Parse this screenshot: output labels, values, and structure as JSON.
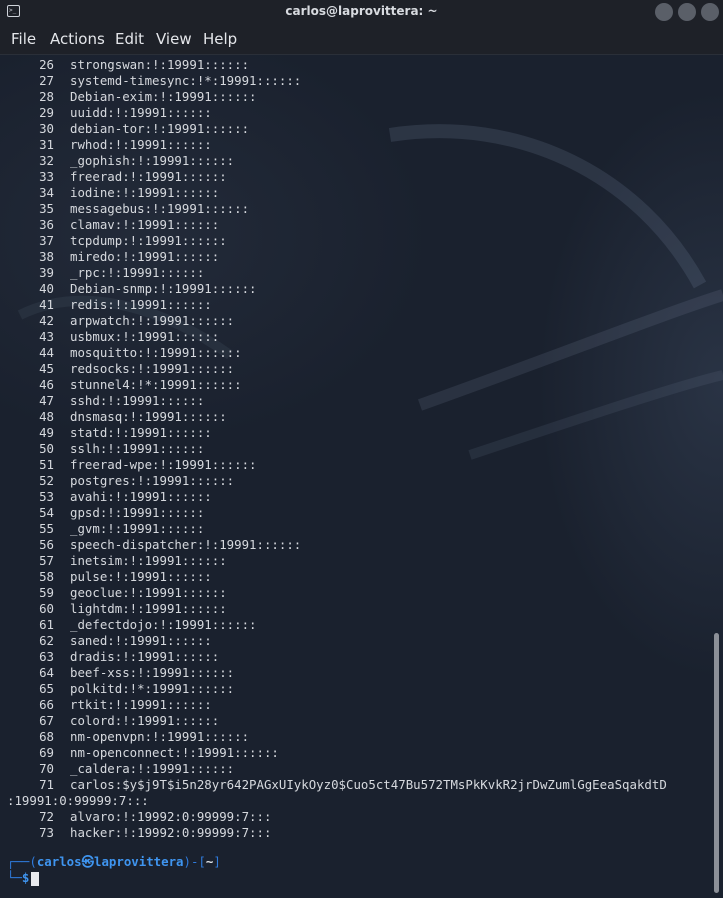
{
  "window": {
    "title": "carlos@laprovittera: ~",
    "icon": "terminal-icon"
  },
  "menu": {
    "items": [
      "File",
      "Actions",
      "Edit",
      "View",
      "Help"
    ]
  },
  "terminal": {
    "lines": [
      {
        "num": "26",
        "text": "strongswan:!:19991::::::"
      },
      {
        "num": "27",
        "text": "systemd-timesync:!*:19991::::::"
      },
      {
        "num": "28",
        "text": "Debian-exim:!:19991::::::"
      },
      {
        "num": "29",
        "text": "uuidd:!:19991::::::"
      },
      {
        "num": "30",
        "text": "debian-tor:!:19991::::::"
      },
      {
        "num": "31",
        "text": "rwhod:!:19991::::::"
      },
      {
        "num": "32",
        "text": "_gophish:!:19991::::::"
      },
      {
        "num": "33",
        "text": "freerad:!:19991::::::"
      },
      {
        "num": "34",
        "text": "iodine:!:19991::::::"
      },
      {
        "num": "35",
        "text": "messagebus:!:19991::::::"
      },
      {
        "num": "36",
        "text": "clamav:!:19991::::::"
      },
      {
        "num": "37",
        "text": "tcpdump:!:19991::::::"
      },
      {
        "num": "38",
        "text": "miredo:!:19991::::::"
      },
      {
        "num": "39",
        "text": "_rpc:!:19991::::::"
      },
      {
        "num": "40",
        "text": "Debian-snmp:!:19991::::::"
      },
      {
        "num": "41",
        "text": "redis:!:19991::::::"
      },
      {
        "num": "42",
        "text": "arpwatch:!:19991::::::"
      },
      {
        "num": "43",
        "text": "usbmux:!:19991::::::"
      },
      {
        "num": "44",
        "text": "mosquitto:!:19991::::::"
      },
      {
        "num": "45",
        "text": "redsocks:!:19991::::::"
      },
      {
        "num": "46",
        "text": "stunnel4:!*:19991::::::"
      },
      {
        "num": "47",
        "text": "sshd:!:19991::::::"
      },
      {
        "num": "48",
        "text": "dnsmasq:!:19991::::::"
      },
      {
        "num": "49",
        "text": "statd:!:19991::::::"
      },
      {
        "num": "50",
        "text": "sslh:!:19991::::::"
      },
      {
        "num": "51",
        "text": "freerad-wpe:!:19991::::::"
      },
      {
        "num": "52",
        "text": "postgres:!:19991::::::"
      },
      {
        "num": "53",
        "text": "avahi:!:19991::::::"
      },
      {
        "num": "54",
        "text": "gpsd:!:19991::::::"
      },
      {
        "num": "55",
        "text": "_gvm:!:19991::::::"
      },
      {
        "num": "56",
        "text": "speech-dispatcher:!:19991::::::"
      },
      {
        "num": "57",
        "text": "inetsim:!:19991::::::"
      },
      {
        "num": "58",
        "text": "pulse:!:19991::::::"
      },
      {
        "num": "59",
        "text": "geoclue:!:19991::::::"
      },
      {
        "num": "60",
        "text": "lightdm:!:19991::::::"
      },
      {
        "num": "61",
        "text": "_defectdojo:!:19991::::::"
      },
      {
        "num": "62",
        "text": "saned:!:19991::::::"
      },
      {
        "num": "63",
        "text": "dradis:!:19991::::::"
      },
      {
        "num": "64",
        "text": "beef-xss:!:19991::::::"
      },
      {
        "num": "65",
        "text": "polkitd:!*:19991::::::"
      },
      {
        "num": "66",
        "text": "rtkit:!:19991::::::"
      },
      {
        "num": "67",
        "text": "colord:!:19991::::::"
      },
      {
        "num": "68",
        "text": "nm-openvpn:!:19991::::::"
      },
      {
        "num": "69",
        "text": "nm-openconnect:!:19991::::::"
      },
      {
        "num": "70",
        "text": "_caldera:!:19991::::::"
      },
      {
        "num": "71",
        "text": "carlos:$y$j9T$i5n28yr642PAGxUIykOyz0$Cuo5ct47Bu572TMsPkKvkR2jrDwZumlGgEeaSqakdtD"
      },
      {
        "num": "",
        "text": ":19991:0:99999:7:::"
      },
      {
        "num": "72",
        "text": "alvaro:!:19992:0:99999:7:::"
      },
      {
        "num": "73",
        "text": "hacker:!:19992:0:99999:7:::"
      }
    ],
    "prompt": {
      "line1_open": "┌──(",
      "user": "carlos㉿laprovittera",
      "bracket_mid": ")-[",
      "dir": "~",
      "bracket_close": "]",
      "line2_corner": "└─",
      "symbol": "$"
    }
  },
  "colors": {
    "background": "#1a212e",
    "text": "#d6d9de",
    "prompt_blue": "#3f95f0"
  }
}
